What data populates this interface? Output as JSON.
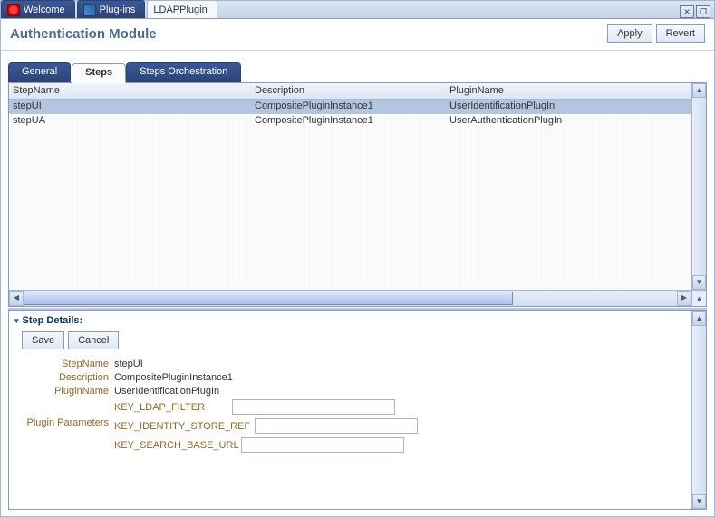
{
  "topTabs": {
    "welcome": "Welcome",
    "plugins": "Plug-ins",
    "current": "LDAPPlugin"
  },
  "pageTitle": "Authentication Module",
  "actions": {
    "apply": "Apply",
    "revert": "Revert"
  },
  "subTabs": {
    "general": "General",
    "steps": "Steps",
    "orchestration": "Steps Orchestration"
  },
  "table": {
    "headers": {
      "c1": "StepName",
      "c2": "Description",
      "c3": "PluginName"
    },
    "rows": [
      {
        "c1": "stepUI",
        "c2": "CompositePluginInstance1",
        "c3": "UserIdentificationPlugIn"
      },
      {
        "c1": "stepUA",
        "c2": "CompositePluginInstance1",
        "c3": "UserAuthenticationPlugIn"
      }
    ]
  },
  "details": {
    "title": "Step Details:",
    "save": "Save",
    "cancel": "Cancel",
    "labels": {
      "stepName": "StepName",
      "description": "Description",
      "pluginName": "PluginName",
      "pluginParams": "Plugin Parameters"
    },
    "values": {
      "stepName": "stepUI",
      "description": "CompositePluginInstance1",
      "pluginName": "UserIdentificationPlugIn"
    },
    "params": {
      "k1": "KEY_LDAP_FILTER",
      "v1": "",
      "k2": "KEY_IDENTITY_STORE_REF",
      "v2": "",
      "k3": "KEY_SEARCH_BASE_URL",
      "v3": ""
    }
  }
}
